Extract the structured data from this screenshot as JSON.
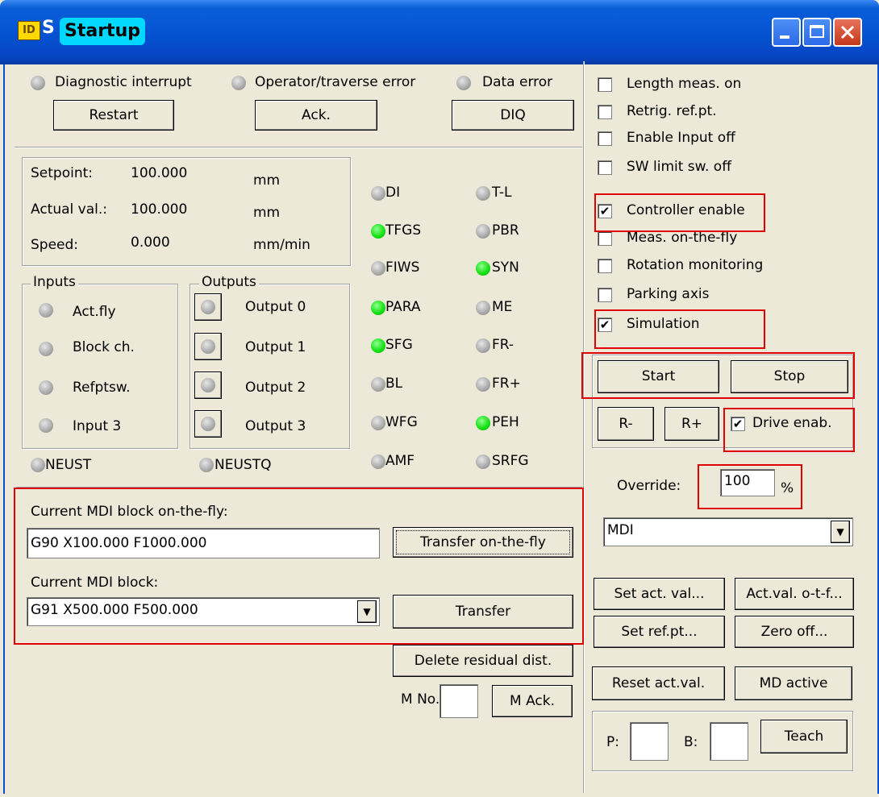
{
  "window": {
    "title_prefix": "S",
    "title": "Startup"
  },
  "errors": {
    "diagnostic": "Diagnostic interrupt",
    "operator": "Operator/traverse error",
    "data": "Data error",
    "restart": "Restart",
    "ack": "Ack.",
    "diq": "DIQ"
  },
  "values": {
    "setpoint_label": "Setpoint:",
    "setpoint_value": "100.000",
    "setpoint_unit": "mm",
    "actual_label": "Actual val.:",
    "actual_value": "100.000",
    "actual_unit": "mm",
    "speed_label": "Speed:",
    "speed_value": "0.000",
    "speed_unit": "mm/min"
  },
  "inputs": {
    "title": "Inputs",
    "items": [
      "Act.fly",
      "Block ch.",
      "Refptsw.",
      "Input 3"
    ]
  },
  "outputs": {
    "title": "Outputs",
    "items": [
      "Output 0",
      "Output 1",
      "Output 2",
      "Output 3"
    ]
  },
  "neust": "NEUST",
  "neustq": "NEUSTQ",
  "status_leds": {
    "col1": [
      {
        "label": "DI",
        "on": false
      },
      {
        "label": "TFGS",
        "on": true
      },
      {
        "label": "FIWS",
        "on": false
      },
      {
        "label": "PARA",
        "on": true
      },
      {
        "label": "SFG",
        "on": true
      },
      {
        "label": "BL",
        "on": false
      },
      {
        "label": "WFG",
        "on": false
      },
      {
        "label": "AMF",
        "on": false
      }
    ],
    "col2": [
      {
        "label": "T-L",
        "on": false
      },
      {
        "label": "PBR",
        "on": false
      },
      {
        "label": "SYN",
        "on": true
      },
      {
        "label": "ME",
        "on": false
      },
      {
        "label": "FR-",
        "on": false
      },
      {
        "label": "FR+",
        "on": false
      },
      {
        "label": "PEH",
        "on": true
      },
      {
        "label": "SRFG",
        "on": false
      }
    ]
  },
  "mdi": {
    "fly_label": "Current MDI block on-the-fly:",
    "fly_value": "G90 X100.000 F1000.000",
    "fly_button": "Transfer on-the-fly",
    "block_label": "Current MDI block:",
    "block_value": "G91 X500.000 F500.000",
    "transfer_button": "Transfer",
    "delete_button": "Delete residual dist.",
    "mno_label": "M No.",
    "mack_button": "M Ack."
  },
  "checkboxes": [
    {
      "label": "Length meas. on",
      "checked": false
    },
    {
      "label": "Retrig. ref.pt.",
      "checked": false
    },
    {
      "label": "Enable Input off",
      "checked": false
    },
    {
      "label": "SW limit sw. off",
      "checked": false
    },
    {
      "label": "Controller enable",
      "checked": true
    },
    {
      "label": "Meas. on-the-fly",
      "checked": false
    },
    {
      "label": "Rotation monitoring",
      "checked": false
    },
    {
      "label": "Parking axis",
      "checked": false
    },
    {
      "label": "Simulation",
      "checked": true
    }
  ],
  "motion": {
    "start": "Start",
    "stop": "Stop",
    "r_minus": "R-",
    "r_plus": "R+",
    "drive_enab": "Drive enab.",
    "drive_enab_checked": true
  },
  "override": {
    "label": "Override:",
    "value": "100",
    "unit": "%"
  },
  "mode": {
    "selected": "MDI"
  },
  "actions": {
    "set_act_val": "Set act. val...",
    "act_val_otf": "Act.val. o-t-f...",
    "set_ref_pt": "Set ref.pt...",
    "zero_off": "Zero off...",
    "reset_act_val": "Reset act.val.",
    "md_active": "MD active"
  },
  "teach": {
    "p_label": "P:",
    "b_label": "B:",
    "button": "Teach"
  }
}
